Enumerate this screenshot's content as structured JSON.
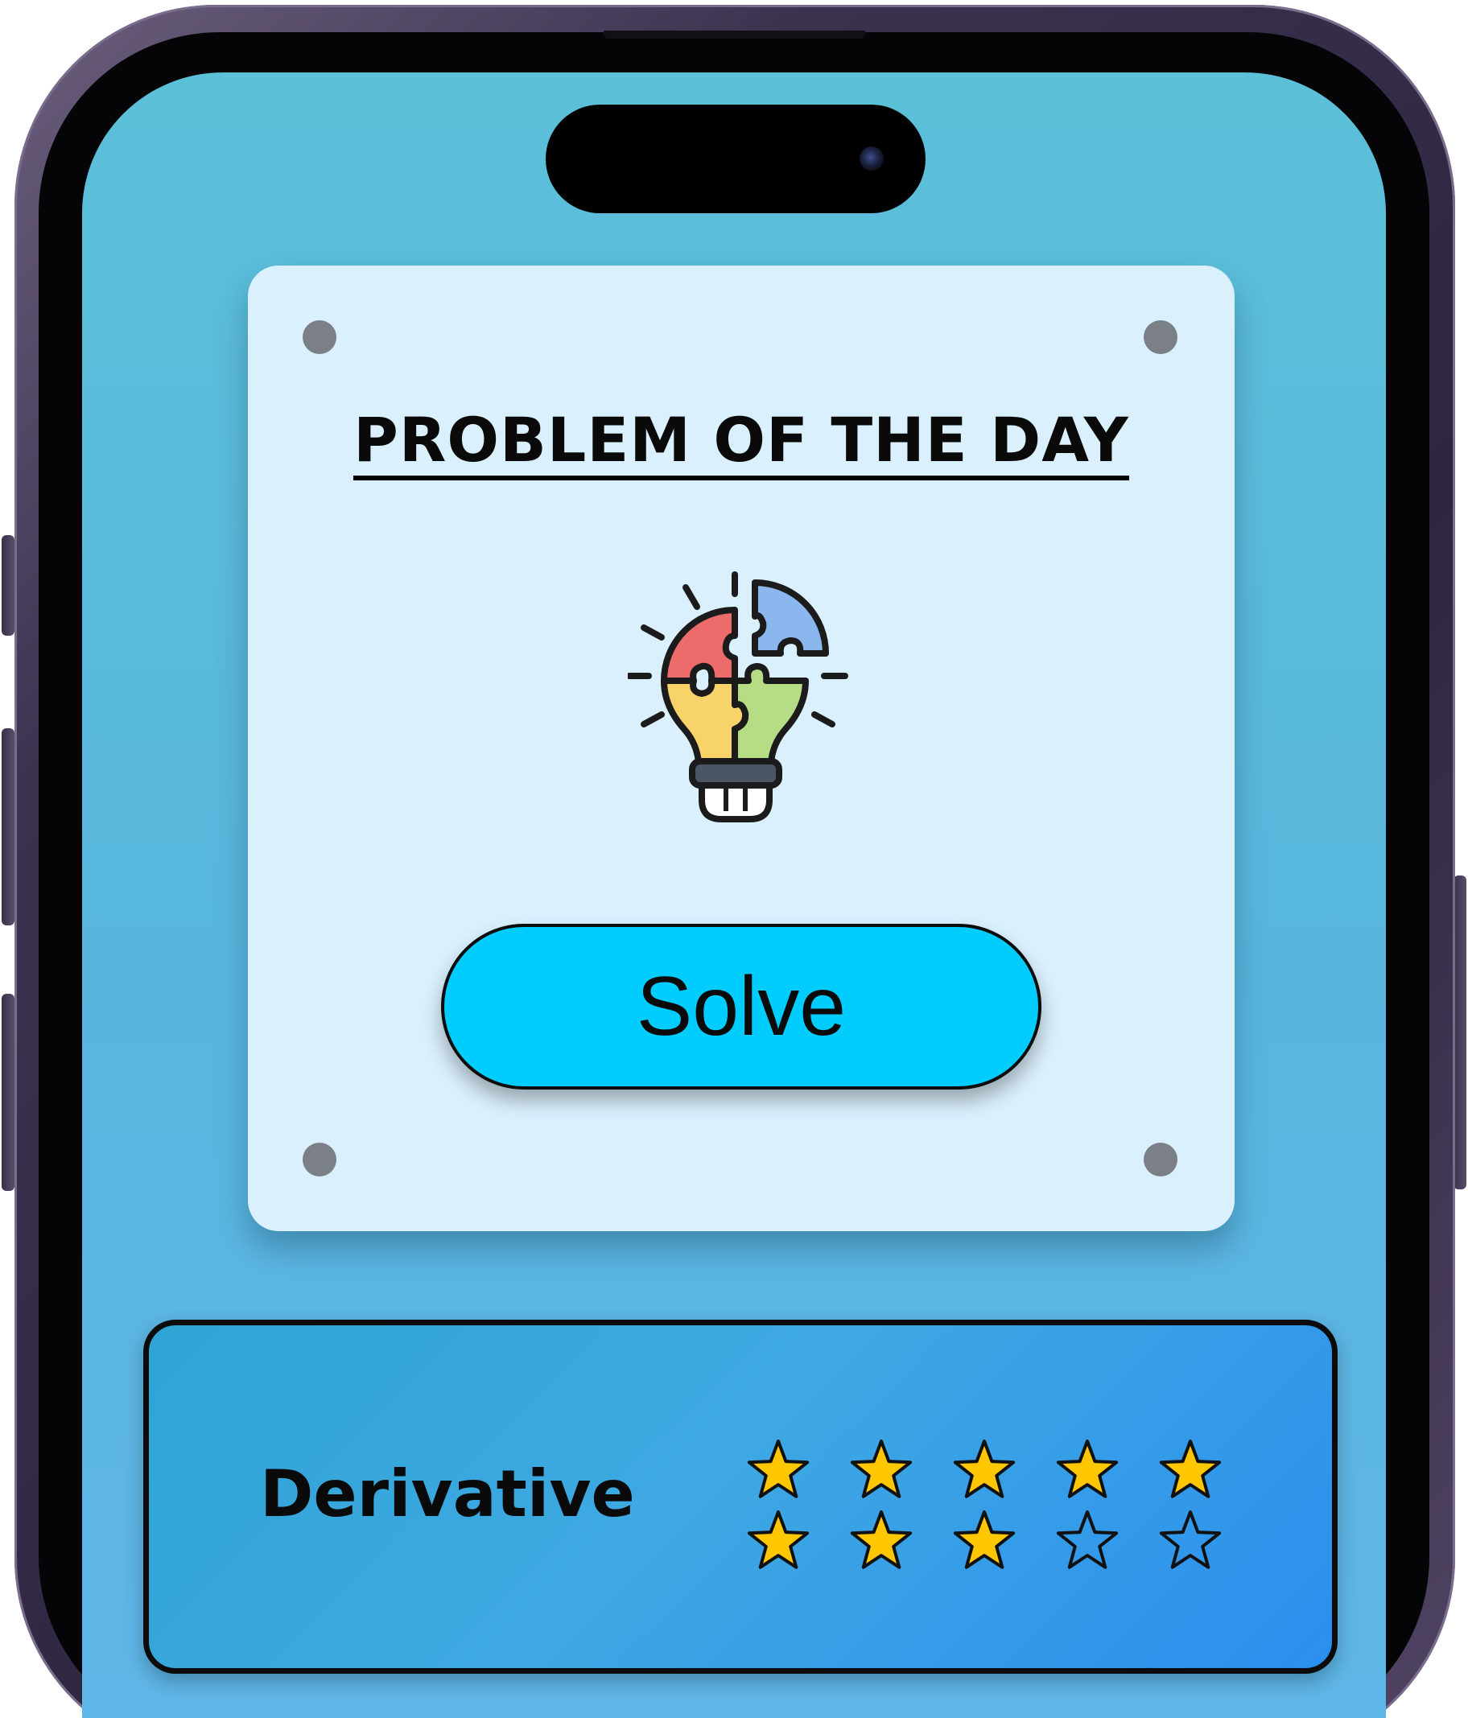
{
  "app": {
    "frame_color": "#3c3250",
    "screen_color": "#5cc0d9"
  },
  "problem_card": {
    "title": "PROBLEM OF THE DAY",
    "icon": "puzzle-lightbulb-icon",
    "solve_label": "Solve",
    "solve_color": "#00ccfe",
    "card_color": "#daf0fd",
    "screw_color": "#7b8086"
  },
  "topic_card": {
    "label": "Derivative",
    "rating": {
      "filled": 8,
      "total": 10
    },
    "star_fill_color": "#ffc700",
    "icons": [
      "star-filled-icon",
      "star-outline-icon"
    ]
  }
}
